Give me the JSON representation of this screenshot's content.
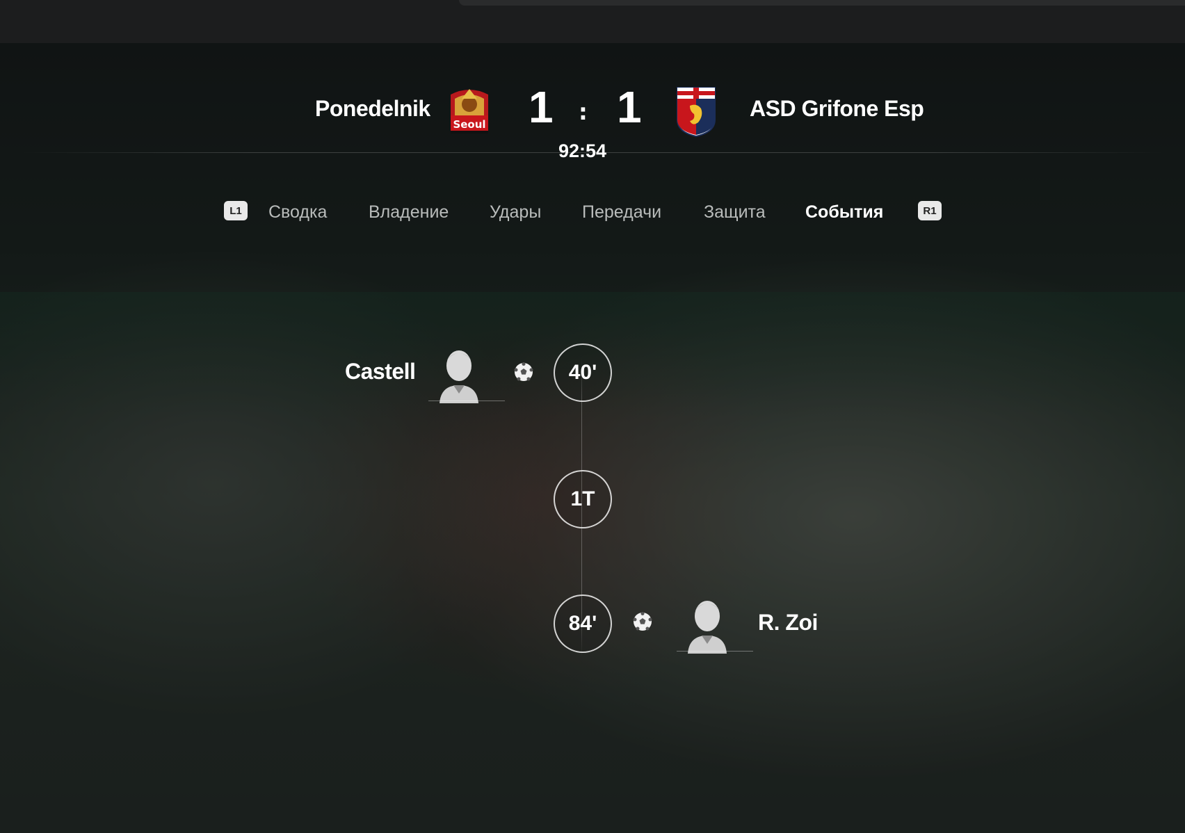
{
  "match": {
    "home_team": "Ponedelnik",
    "away_team": "ASD Grifone Esp",
    "home_score": "1",
    "away_score": "1",
    "separator": ":",
    "clock": "92:54",
    "home_crest_text": "Seoul"
  },
  "tabs": {
    "left_bumper": "L1",
    "right_bumper": "R1",
    "items": [
      "Сводка",
      "Владение",
      "Удары",
      "Передачи",
      "Защита",
      "События"
    ],
    "active": "События"
  },
  "events": [
    {
      "side": "home",
      "minute": "40'",
      "player": "Castell",
      "type": "goal"
    },
    {
      "side": "center",
      "minute": "1T"
    },
    {
      "side": "away",
      "minute": "84'",
      "player": "R. Zoi",
      "type": "goal"
    }
  ],
  "icons": {
    "home_crest": "fc-seoul-crest",
    "away_crest": "genoa-crest",
    "goal_icon": "soccer-ball-icon",
    "player_icon": "player-silhouette-icon"
  },
  "colors": {
    "text_primary": "#ffffff",
    "tab_inactive": "#b9bcbb",
    "bumper_bg": "#e9e9e9"
  }
}
